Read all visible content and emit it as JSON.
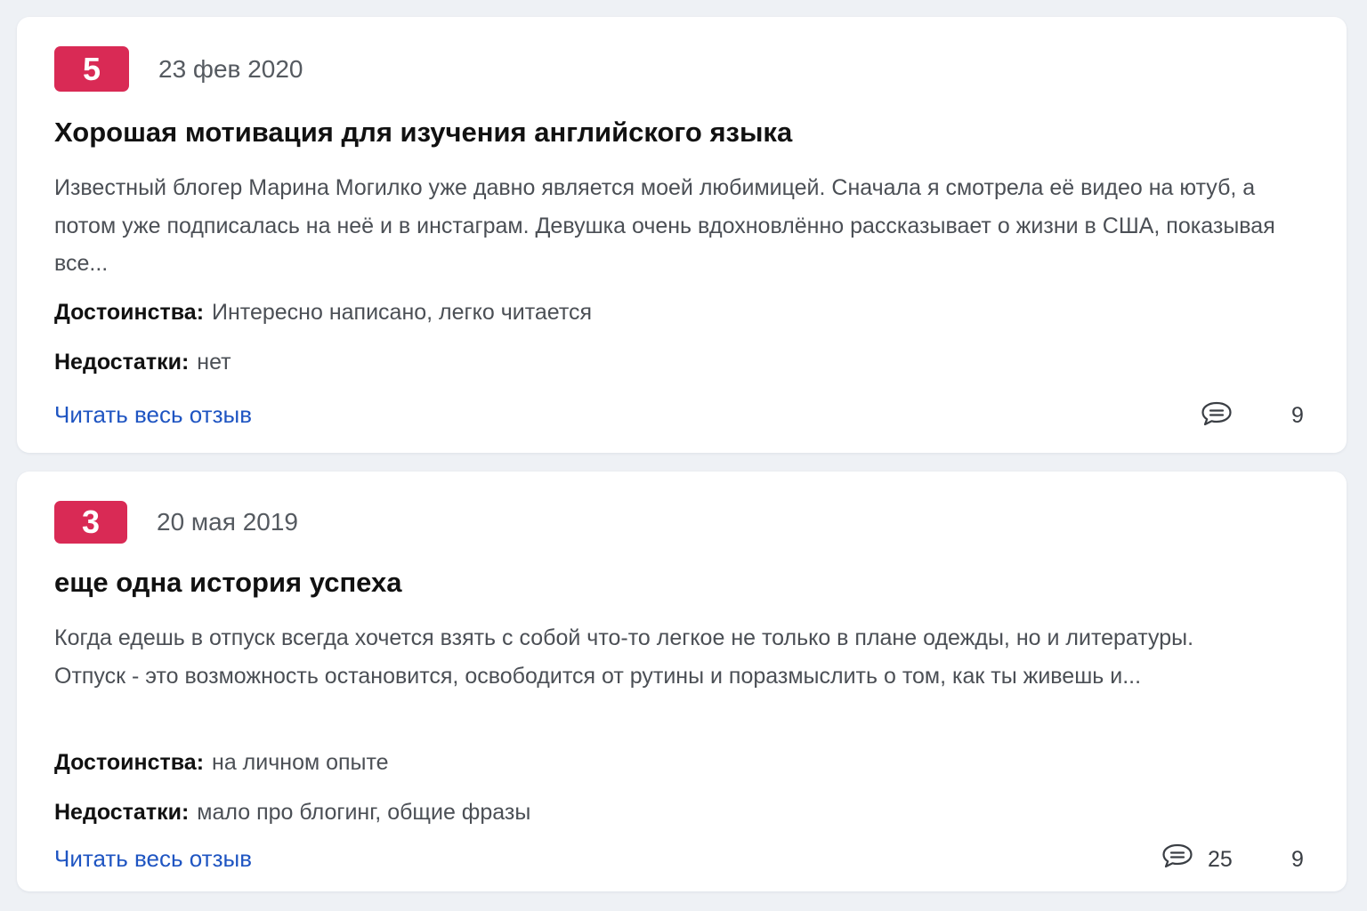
{
  "reviews": [
    {
      "rating": "5",
      "date": "23 фев 2020",
      "title": "Хорошая мотивация для изучения английского языка",
      "excerpt": "Известный блогер Марина Могилко уже давно является моей любимицей. Сначала я смотрела её видео на ютуб, а потом уже подписалась на неё и в инстаграм. Девушка очень вдохновлённо рассказывает о жизни в США, показывая все...",
      "pros_label": "Достоинства:",
      "pros": "Интересно написано, легко читается",
      "cons_label": "Недостатки:",
      "cons": "нет",
      "read_link": "Читать весь отзыв",
      "comments_icon": "comment-bubble-icon",
      "comment_count": "",
      "second_count": "9"
    },
    {
      "rating": "3",
      "date": "20 мая 2019",
      "title": "еще одна история успеха",
      "excerpt": "Когда едешь в отпуск всегда хочется взять с собой что-то легкое не только в плане одежды, но и литературы. Отпуск - это возможность остановится, освободится от рутины и поразмыслить о том, как ты живешь и...",
      "pros_label": "Достоинства:",
      "pros": "на личном опыте",
      "cons_label": "Недостатки:",
      "cons": "мало про блогинг, общие фразы",
      "read_link": "Читать весь отзыв",
      "comments_icon": "comment-bubble-icon",
      "comment_count": "25",
      "second_count": "9"
    }
  ],
  "colors": {
    "rating_badge": "#d92a55",
    "link": "#1f55c2",
    "background": "#eef1f5"
  }
}
